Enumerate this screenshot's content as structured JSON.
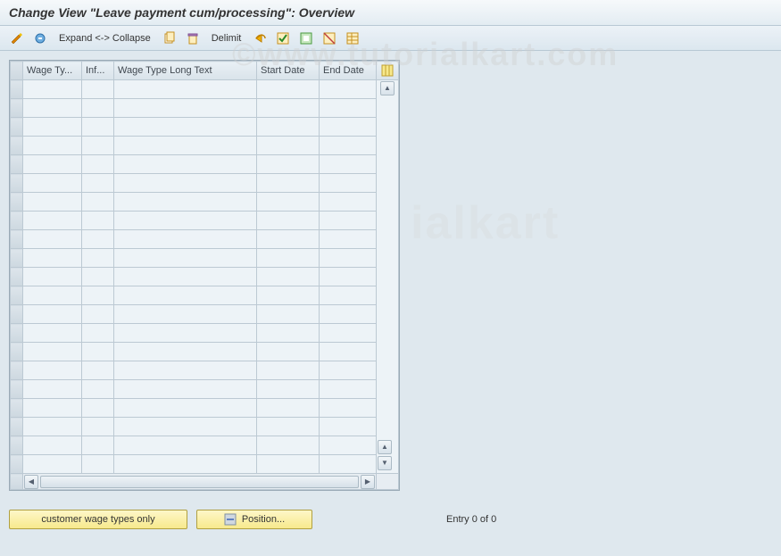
{
  "title": "Change View \"Leave payment cum/processing\": Overview",
  "toolbar": {
    "expand": "Expand <-> Collapse",
    "delimit": "Delimit"
  },
  "columns": {
    "wage_type": "Wage Ty...",
    "infotype": "Inf...",
    "wage_long": "Wage Type Long Text",
    "start_date": "Start Date",
    "end_date": "End Date"
  },
  "num_rows": 21,
  "footer": {
    "customer_btn": "customer wage types only",
    "position_btn": "Position...",
    "entry_text": "Entry 0 of 0"
  },
  "watermark1": "©www.tutorialkart.com",
  "watermark2": "ialkart"
}
